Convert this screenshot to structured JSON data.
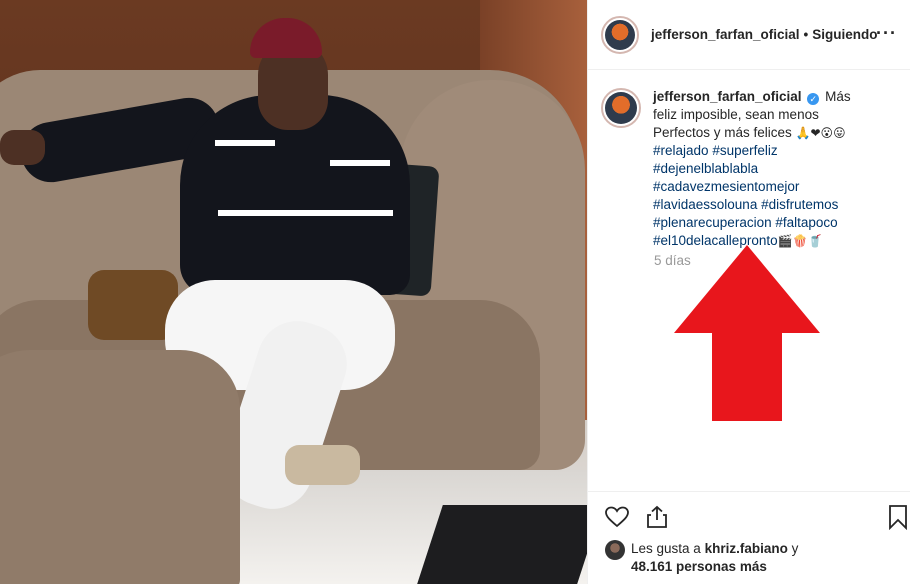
{
  "post": {
    "username": "jefferson_farfan_oficial",
    "header_separator": "•",
    "follow_status": "Siguiendo",
    "more_icon": "more-options-icon",
    "caption_text": "Más feliz imposible, sean menos Perfectos y más felices",
    "caption_emojis": "🙏❤😮😛",
    "hashtags": [
      "#relajado",
      "#superfeliz",
      "#dejenelblablabla",
      "#cadavezmesientomejor",
      "#lavidaessolouna",
      "#disfrutemos",
      "#plenarecuperacion",
      "#faltapoco",
      "#el10delacallepronto"
    ],
    "trailing_emojis": "🎬🍿🥤",
    "time_ago": "5 días",
    "verified_icon": "verified-badge-icon"
  },
  "actions": {
    "like_icon": "heart-icon",
    "share_icon": "share-icon",
    "save_icon": "bookmark-icon",
    "likes_prefix": "Les gusta a",
    "likes_user": "khriz.fabiano",
    "likes_and": "y",
    "likes_count": "48.161 personas más"
  },
  "colors": {
    "arrow": "#e8161c",
    "hashtag": "#003569",
    "verified": "#3897f0"
  }
}
